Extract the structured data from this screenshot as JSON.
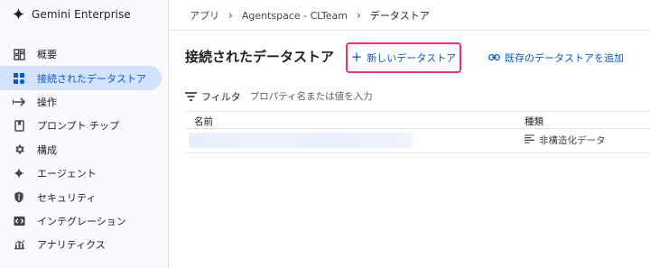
{
  "app": {
    "title": "Gemini Enterprise"
  },
  "sidebar": {
    "items": [
      {
        "label": "概要",
        "icon": "overview-icon",
        "active": false
      },
      {
        "label": "接続されたデータストア",
        "icon": "datastore-icon",
        "active": true
      },
      {
        "label": "操作",
        "icon": "operations-arrow-icon",
        "active": false
      },
      {
        "label": "プロンプト チップ",
        "icon": "bookmark-icon",
        "active": false
      },
      {
        "label": "構成",
        "icon": "gear-icon",
        "active": false
      },
      {
        "label": "エージェント",
        "icon": "sparkle-icon",
        "active": false
      },
      {
        "label": "セキュリティ",
        "icon": "shield-icon",
        "active": false
      },
      {
        "label": "インテグレーション",
        "icon": "code-icon",
        "active": false
      },
      {
        "label": "アナリティクス",
        "icon": "analytics-icon",
        "active": false
      }
    ]
  },
  "breadcrumb": {
    "items": [
      "アプリ",
      "Agentspace - CLTeam",
      "データストア"
    ]
  },
  "main": {
    "title": "接続されたデータストア",
    "new_button_label": "新しいデータストア",
    "add_existing_label": "既存のデータストアを追加"
  },
  "filter": {
    "label": "フィルタ",
    "placeholder": "プロパティ名または値を入力"
  },
  "table": {
    "headers": {
      "name": "名前",
      "type": "種類"
    },
    "rows": [
      {
        "name": "",
        "type": "非構造化データ"
      }
    ]
  },
  "colors": {
    "accent": "#0b57d0",
    "active_bg": "#d3e3fd",
    "highlight_border": "#e8336b"
  }
}
